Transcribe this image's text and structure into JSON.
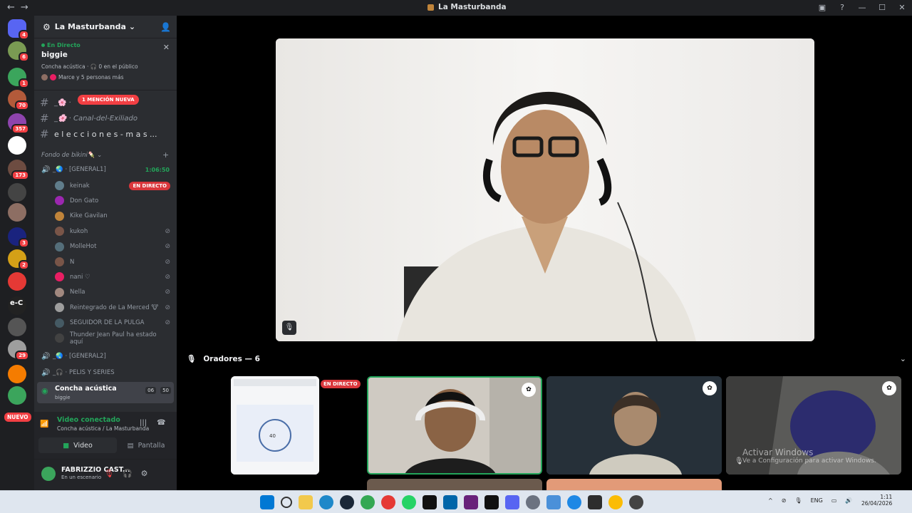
{
  "window": {
    "title": "La Masturbanda",
    "back": "←",
    "forward": "→"
  },
  "guilds": [
    {
      "name": "discord-home",
      "color": "#5865f2",
      "badge": "4"
    },
    {
      "name": "server-1",
      "color": "#7a9b53",
      "badge": "6"
    },
    {
      "name": "server-2",
      "color": "#3ba55c",
      "badge": "1"
    },
    {
      "name": "server-3",
      "color": "#b35a3a",
      "badge": "70"
    },
    {
      "name": "server-4",
      "color": "#8e44ad",
      "badge": "357"
    },
    {
      "name": "server-5",
      "color": "#ffffff",
      "badge": ""
    },
    {
      "name": "server-6",
      "color": "#6d4c41",
      "badge": "173"
    },
    {
      "name": "server-7",
      "color": "#444",
      "badge": ""
    },
    {
      "name": "server-8",
      "color": "#8d6e63",
      "badge": ""
    },
    {
      "name": "server-9",
      "color": "#1a237e",
      "badge": "3"
    },
    {
      "name": "server-10",
      "color": "#d4a017",
      "badge": "2"
    },
    {
      "name": "server-11",
      "color": "#e53935",
      "badge": ""
    },
    {
      "name": "server-12",
      "color": "#222",
      "badge": ""
    },
    {
      "name": "server-13",
      "color": "#555",
      "badge": ""
    },
    {
      "name": "server-14",
      "color": "#9e9e9e",
      "badge": "29"
    },
    {
      "name": "server-15",
      "color": "#f57c00",
      "badge": ""
    },
    {
      "name": "server-16",
      "color": "#3ba55c",
      "badge": ""
    }
  ],
  "guild_labels": {
    "nuevo": "NUEVO",
    "ec": "e-C"
  },
  "server": {
    "name": "La Masturbanda",
    "chevron": "⌄"
  },
  "live": {
    "label": "En Directo",
    "name": "biggie",
    "info": "Concha acústica · 🎧 0 en el público",
    "people": "Marce y 5 personas más"
  },
  "text_channels": [
    {
      "name": "_​🌸 ·",
      "mention": "1 MENCIÓN NUEVA"
    },
    {
      "name": "_🌸 · Canal-del-Exiliado"
    },
    {
      "name": "e l e c c i o n e s - m a s ..."
    }
  ],
  "category": {
    "name": "Fondo de bikini🍡 ⌄"
  },
  "voice_general1": {
    "name": "_🌏 · [GENERAL1]",
    "time": "1:06:50"
  },
  "voice_users": [
    {
      "name": "keinak",
      "status": "EN DIRECTO",
      "color": "#607d8b"
    },
    {
      "name": "Don Gato",
      "status": "",
      "color": "#9c27b0"
    },
    {
      "name": "Kike Gavilan",
      "status": "",
      "color": "#c0843a"
    },
    {
      "name": "kukoh",
      "status": "mute",
      "color": "#795548"
    },
    {
      "name": "MolleHot",
      "status": "mute",
      "color": "#546e7a"
    },
    {
      "name": "N",
      "status": "mute",
      "color": "#795548"
    },
    {
      "name": "nani ♡",
      "status": "mute",
      "color": "#e91e63"
    },
    {
      "name": "Nella",
      "status": "mute",
      "color": "#a1887f"
    },
    {
      "name": "Reintegrado de La Merced 🐮",
      "status": "mute",
      "color": "#9e9e9e"
    },
    {
      "name": "SEGUIDOR DE LA PULGA",
      "status": "mute",
      "color": "#455a64"
    },
    {
      "name": "Thunder Jean Paul ha estado aquí",
      "status": "",
      "color": "#424242"
    }
  ],
  "voice_general2": {
    "name": "_🌏 · [GENERAL2]"
  },
  "voice_pelis": {
    "name": "_🎧 · PELIS Y SERIES"
  },
  "stage_channel": {
    "name": "Concha acústica",
    "sub": "biggie",
    "count1": "06",
    "count2": "50"
  },
  "connection": {
    "status": "Video conectado",
    "sub": "Concha acústica / La Masturbanda",
    "video_label": "Video",
    "screen_label": "Pantalla"
  },
  "user": {
    "name": "FABRIZZIO CAST...",
    "status": "En un escenario"
  },
  "stage": {
    "speakers_label": "Oradores — 6",
    "live_tag": "EN DIRECTO",
    "tile_number": "40"
  },
  "watermark": {
    "title": "Activar Windows",
    "sub": "Ve a Configuración para activar Windows."
  },
  "taskbar": {
    "lang": "ENG",
    "time": "1:11",
    "date": "26/04/2026"
  },
  "icons": {
    "mute": "🎙",
    "close": "✕",
    "plus": "+",
    "speaker": "🔊"
  },
  "colors": {
    "accent": "#23a55a",
    "danger": "#da373c",
    "bg": "#2b2d31"
  }
}
